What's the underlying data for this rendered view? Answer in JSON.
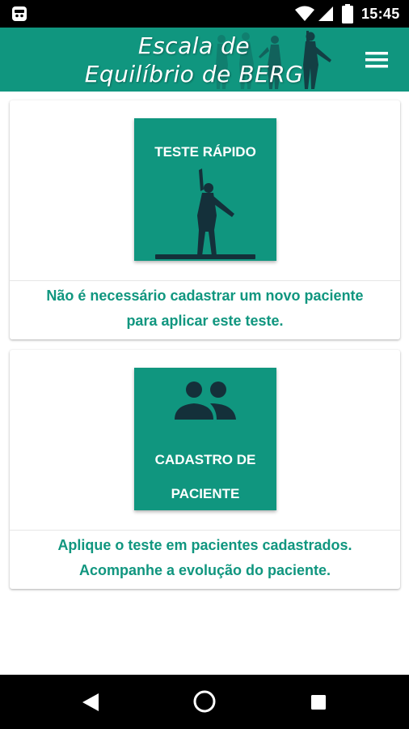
{
  "status_bar": {
    "time": "15:45",
    "icons": [
      "notification-icon",
      "wifi-icon",
      "cellular-icon",
      "battery-icon"
    ]
  },
  "app_bar": {
    "title_line1": "Escala de",
    "title_line2": "Equilíbrio de BERG",
    "menu_icon": "hamburger-menu-icon"
  },
  "cards": [
    {
      "tile_label": "TESTE RÁPIDO",
      "tile_icon": "balance-figure-icon",
      "desc_line1": "Não é necessário cadastrar um novo paciente",
      "desc_line2": "para aplicar este teste."
    },
    {
      "tile_label_line1": "CADASTRO DE",
      "tile_label_line2": "PACIENTE",
      "tile_icon": "people-icon",
      "desc_line1": "Aplique o teste em pacientes cadastrados.",
      "desc_line2": "Acompanhe a evolução do paciente."
    }
  ],
  "nav_bar": {
    "icons": [
      "back-icon",
      "home-icon",
      "recents-icon"
    ]
  },
  "colors": {
    "primary": "#10967f",
    "silhouette": "#14303a",
    "status_bar": "#000000",
    "card_background": "#ffffff"
  }
}
